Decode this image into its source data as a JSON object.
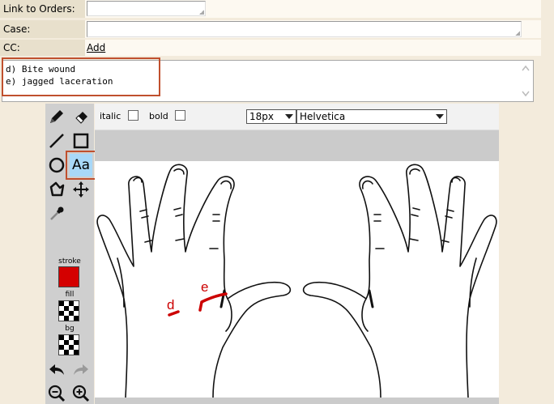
{
  "form": {
    "link_to_orders_label": "Link to Orders:",
    "link_to_orders_value": "",
    "case_label": "Case:",
    "case_value": "",
    "cc_label": "CC:",
    "cc_add_link": "Add",
    "notes_text": "d) Bite wound\ne) jagged laceration"
  },
  "text_toolbar": {
    "italic_label": "italic",
    "bold_label": "bold",
    "italic_checked": false,
    "bold_checked": false,
    "font_size": "18px",
    "font_family": "Helvetica"
  },
  "tools": {
    "text_tool_label": "Aa",
    "stroke_label": "stroke",
    "fill_label": "fill",
    "bg_label": "bg",
    "stroke_color": "#d40000",
    "active_tool": "text"
  },
  "annotations": {
    "mark_d": "d",
    "mark_e": "e",
    "annotation_color": "#cc0000"
  },
  "colors": {
    "highlight_border": "#c0502e",
    "page_bg": "#f3ebdc",
    "active_tool_bg": "#a8d8f8"
  }
}
